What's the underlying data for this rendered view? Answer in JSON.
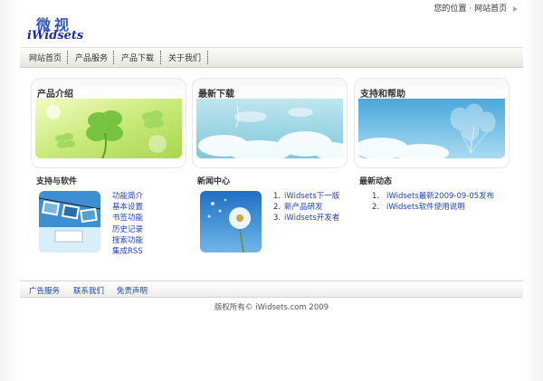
{
  "header": {
    "logo_cn": "微视",
    "logo_en": "iWidsets",
    "location_label": "您的位置",
    "location_separator": "·",
    "location_current": "网站首页"
  },
  "nav": {
    "items": [
      {
        "label": "网站首页"
      },
      {
        "label": "产品服务"
      },
      {
        "label": "产品下载"
      },
      {
        "label": "关于我们"
      }
    ]
  },
  "boxes": [
    {
      "title": "产品介绍",
      "image": "clover-leaves-illustration"
    },
    {
      "title": "最新下载",
      "image": "sky-clouds-illustration"
    },
    {
      "title": "支持和帮助",
      "image": "sky-balloons-illustration"
    }
  ],
  "support": {
    "title": "支持与软件",
    "image": "photo-strip-illustration",
    "links": [
      "功能简介",
      "基本设置",
      "书签功能",
      "历史记录",
      "搜索功能",
      "集成RSS"
    ]
  },
  "news": {
    "title": "新闻中心",
    "image": "dandelion-illustration",
    "items": [
      {
        "num": "1.",
        "text": "iWidsets下一版"
      },
      {
        "num": "2.",
        "text": "新产品研发"
      },
      {
        "num": "3.",
        "text": "iWidsets开发者"
      }
    ]
  },
  "latest": {
    "title": "最新动态",
    "items": [
      {
        "num": "1.",
        "text": "iWidsets最新2009-09-05发布"
      },
      {
        "num": "2.",
        "text": "iWidsets软件使用说明"
      }
    ]
  },
  "footer": {
    "links": [
      "广告服务",
      "联系我们",
      "免责声明"
    ],
    "copyright": "版权所有© iWidsets.com 2009"
  },
  "colors": {
    "link": "#2244bb",
    "logo": "#3355cc",
    "nav_bg": "#e6e6e0"
  }
}
